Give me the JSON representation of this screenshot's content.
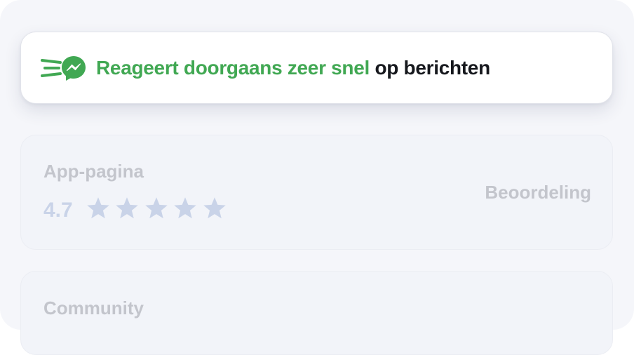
{
  "highlight": {
    "icon": "messenger-icon",
    "text_highlight": "Reageert doorgaans zeer snel",
    "text_rest": "op berichten",
    "accent_color": "#41a853",
    "text_color": "#16181d"
  },
  "app_page": {
    "title": "App-pagina",
    "rating": "4.7",
    "stars": 5,
    "side_label": "Beoordeling",
    "star_color": "#c9d3e8"
  },
  "community": {
    "title": "Community"
  }
}
